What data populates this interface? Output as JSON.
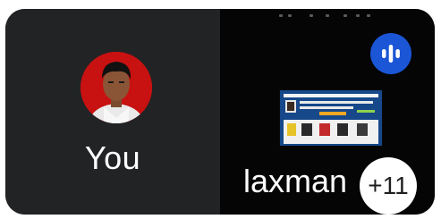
{
  "self_tile": {
    "name": "You",
    "avatar": "avatar-photo"
  },
  "remote_tile": {
    "name": "laxman",
    "audio_icon": "audio-activity-icon",
    "content": "screen-share-thumbnail"
  },
  "overflow": {
    "label": "+11"
  },
  "colors": {
    "self_bg": "#222325",
    "remote_bg": "#050505",
    "accent": "#1a56d6",
    "avatar_bg": "#c81111"
  }
}
